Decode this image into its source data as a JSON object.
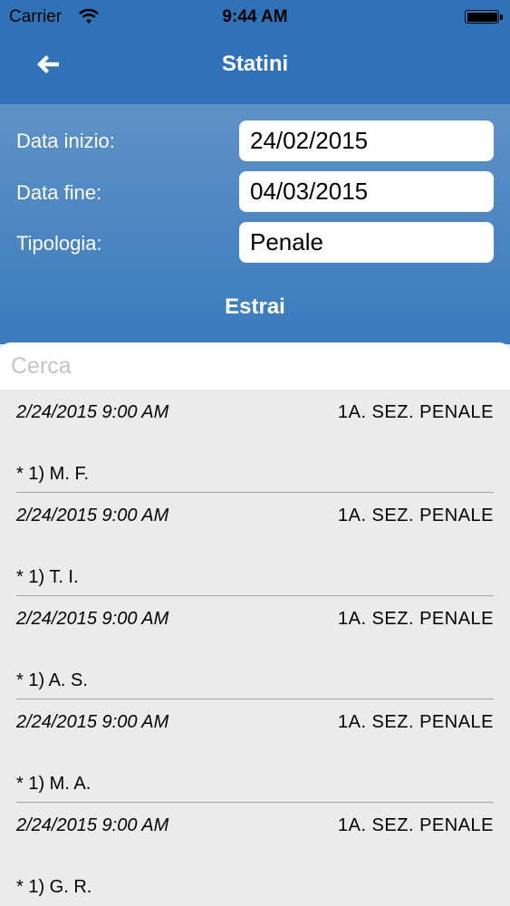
{
  "status_bar": {
    "carrier": "Carrier",
    "time": "9:44 AM"
  },
  "nav": {
    "title": "Statini",
    "back_icon": "arrow-left-icon"
  },
  "form": {
    "start_label": "Data inizio:",
    "start_value": "24/02/2015",
    "end_label": "Data fine:",
    "end_value": "04/03/2015",
    "type_label": "Tipologia:",
    "type_value": "Penale",
    "extract_label": "Estrai"
  },
  "search": {
    "placeholder": "Cerca"
  },
  "items": [
    {
      "date": "2/24/2015 9:00 AM",
      "section": "1A. SEZ. PENALE",
      "name": "* 1) M. F."
    },
    {
      "date": "2/24/2015 9:00 AM",
      "section": "1A. SEZ. PENALE",
      "name": "* 1) T. I."
    },
    {
      "date": "2/24/2015 9:00 AM",
      "section": "1A. SEZ. PENALE",
      "name": "* 1) A. S."
    },
    {
      "date": "2/24/2015 9:00 AM",
      "section": "1A. SEZ. PENALE",
      "name": "* 1) M. A."
    },
    {
      "date": "2/24/2015 9:00 AM",
      "section": "1A. SEZ. PENALE",
      "name": "* 1) G. R."
    }
  ],
  "colors": {
    "accent": "#2f72b8",
    "form_bg": "#4f86c1",
    "list_bg": "#ebebeb"
  }
}
